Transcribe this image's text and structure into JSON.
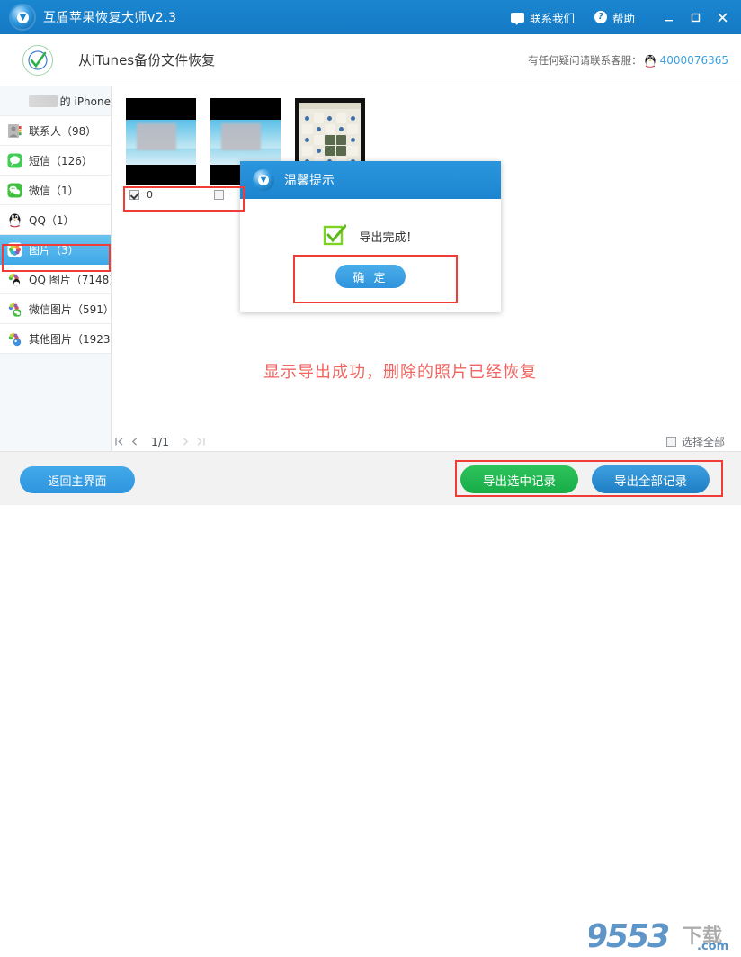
{
  "titlebar": {
    "app_title": "互盾苹果恢复大师v2.3",
    "logo_icon": "shield-logo-icon",
    "contact_label": "联系我们",
    "contact_icon": "chat-bubble-icon",
    "help_label": "帮助",
    "help_icon": "question-circle-icon",
    "minimize_icon": "minimize-icon",
    "maximize_icon": "maximize-icon",
    "close_icon": "close-icon",
    "bg_color": "#1a86d0"
  },
  "subheader": {
    "check_icon": "green-check-circle-icon",
    "title": "从iTunes备份文件恢复",
    "service_label": "有任何疑问请联系客服：",
    "qq_icon": "qq-penguin-icon",
    "phone": "4000076365",
    "phone_color": "#3ba0e0"
  },
  "sidebar": {
    "device": {
      "name_masked": "",
      "label": "的 iPhone",
      "icon": "device-iphone-icon"
    },
    "items": [
      {
        "label": "联系人（98）",
        "icon": "contacts-icon",
        "selected": false
      },
      {
        "label": "短信（126）",
        "icon": "sms-icon",
        "selected": false
      },
      {
        "label": "微信（1）",
        "icon": "wechat-icon",
        "selected": false
      },
      {
        "label": "QQ（1）",
        "icon": "qq-icon",
        "selected": false
      },
      {
        "label": "图片（3）",
        "icon": "photos-icon",
        "selected": true
      },
      {
        "label": "QQ 图片（7148）",
        "icon": "qq-photos-icon",
        "selected": false
      },
      {
        "label": "微信图片（591）",
        "icon": "wechat-photos-icon",
        "selected": false
      },
      {
        "label": "其他图片（1923）",
        "icon": "other-photos-icon",
        "selected": false
      }
    ]
  },
  "content": {
    "thumbnails": [
      {
        "name": "0",
        "checked": true,
        "kind": "photo"
      },
      {
        "name": "",
        "checked": false,
        "kind": "photo"
      },
      {
        "name": "",
        "checked": false,
        "kind": "document"
      }
    ],
    "annotation_text": "显示导出成功，删除的照片已经恢复",
    "annotation_color": "#f0645f"
  },
  "dialog": {
    "logo_icon": "shield-logo-icon",
    "title": "温馨提示",
    "status_icon": "green-check-box-icon",
    "message": "导出完成！",
    "confirm_label": "确 定"
  },
  "pager": {
    "first_icon": "first-page-icon",
    "prev_icon": "prev-page-icon",
    "page_text": "1/1",
    "next_icon": "next-page-icon",
    "last_icon": "last-page-icon",
    "select_all_label": "选择全部",
    "select_all_checked": false
  },
  "footer": {
    "back_label": "返回主界面",
    "export_selected_label": "导出选中记录",
    "export_all_label": "导出全部记录",
    "green_color": "#1fb94f",
    "blue_color": "#2f8ecd"
  },
  "watermark": {
    "digits": "9553",
    "cn": "下载",
    "suffix": ".com"
  }
}
